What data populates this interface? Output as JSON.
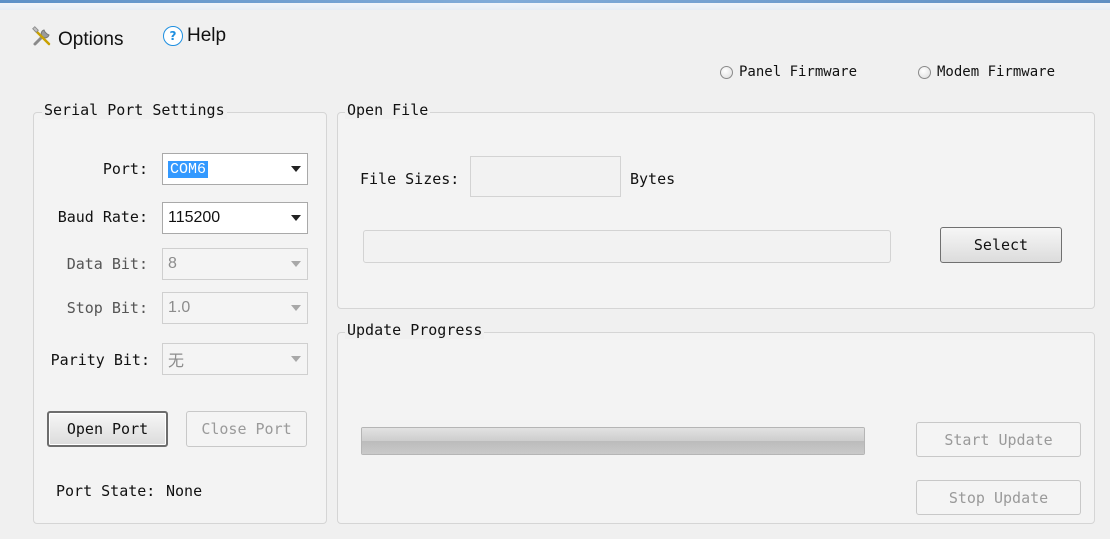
{
  "menu": {
    "options": {
      "label": "Options",
      "icon": "tools-icon"
    },
    "help": {
      "label": "Help",
      "icon": "help-icon"
    }
  },
  "firmware": {
    "panel": {
      "label": "Panel Firmware",
      "selected": false
    },
    "modem": {
      "label": "Modem Firmware",
      "selected": false
    }
  },
  "serial": {
    "title": "Serial Port Settings",
    "port": {
      "label": "Port:",
      "value": "COM6"
    },
    "baud": {
      "label": "Baud Rate:",
      "value": "115200"
    },
    "data_bit": {
      "label": "Data Bit:",
      "value": "8"
    },
    "stop_bit": {
      "label": "Stop Bit:",
      "value": "1.0"
    },
    "parity": {
      "label": "Parity Bit:",
      "value": "无"
    },
    "open_port": "Open Port",
    "close_port": "Close Port",
    "state_label": "Port State:",
    "state_value": "None"
  },
  "open_file": {
    "title": "Open File",
    "file_sizes_label": "File Sizes:",
    "file_sizes_value": "",
    "bytes_label": "Bytes",
    "path_value": "",
    "select": "Select"
  },
  "update": {
    "title": "Update Progress",
    "progress_fraction": 1.0,
    "start": "Start Update",
    "stop": "Stop Update"
  },
  "colors": {
    "selection": "#3399ff",
    "help_icon": "#1e8fe0"
  }
}
